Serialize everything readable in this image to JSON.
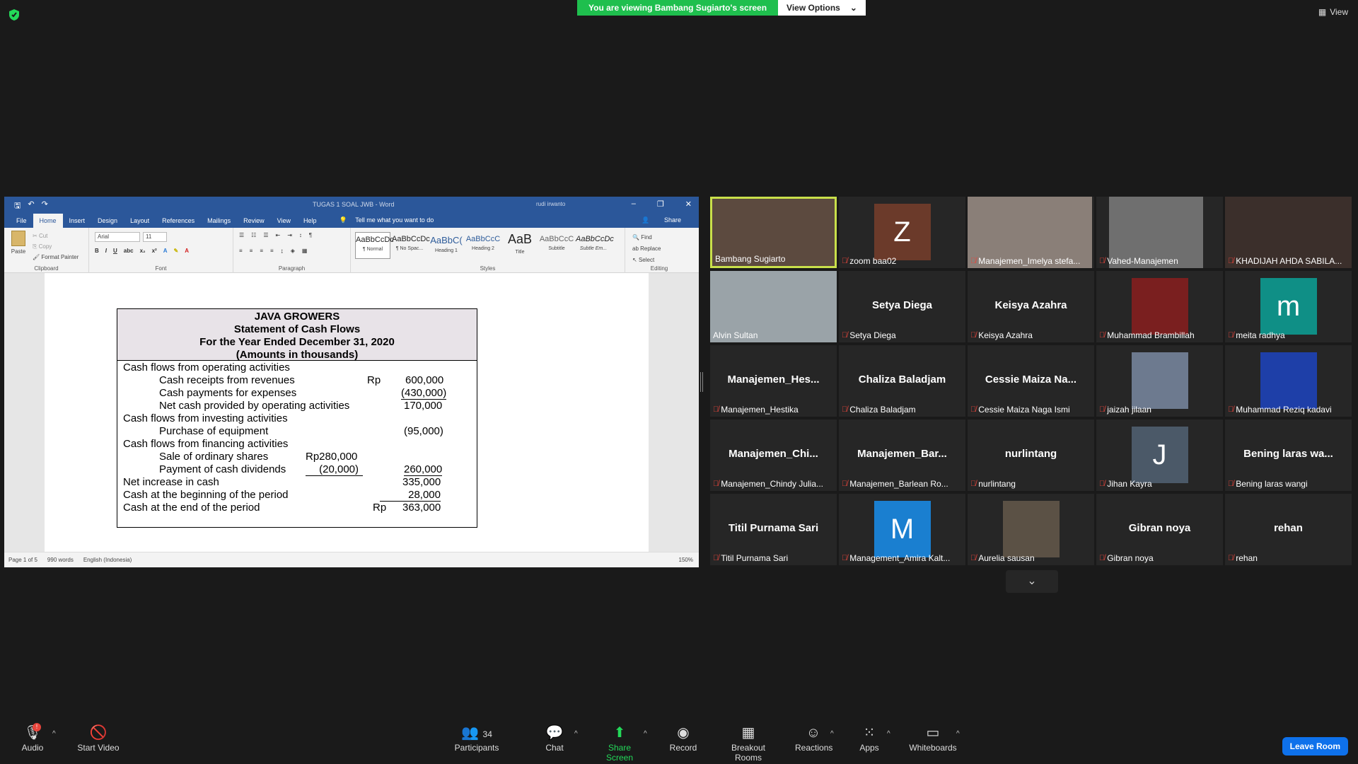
{
  "banner": {
    "viewing": "You are viewing Bambang Sugiarto's screen",
    "view_options": "View Options"
  },
  "view_label": "View",
  "word": {
    "title": "TUGAS 1 SOAL JWB  -  Word",
    "user": "rudi irwanto",
    "tabs": [
      "File",
      "Home",
      "Insert",
      "Design",
      "Layout",
      "References",
      "Mailings",
      "Review",
      "View",
      "Help"
    ],
    "tell_me": "Tell me what you want to do",
    "share": "Share",
    "clipboard": {
      "paste": "Paste",
      "cut": "Cut",
      "copy": "Copy",
      "format_painter": "Format Painter",
      "label": "Clipboard"
    },
    "font": {
      "name": "Arial",
      "size": "11",
      "label": "Font"
    },
    "paragraph_label": "Paragraph",
    "styles": [
      {
        "preview": "AaBbCcDc",
        "name": "¶ Normal"
      },
      {
        "preview": "AaBbCcDc",
        "name": "¶ No Spac..."
      },
      {
        "preview": "AaBbC(",
        "name": "Heading 1"
      },
      {
        "preview": "AaBbCcC",
        "name": "Heading 2"
      },
      {
        "preview": "AaB",
        "name": "Title"
      },
      {
        "preview": "AaBbCcC",
        "name": "Subtitle"
      },
      {
        "preview": "AaBbCcDc",
        "name": "Subtle Em..."
      }
    ],
    "styles_label": "Styles",
    "editing": {
      "find": "Find",
      "replace": "Replace",
      "select": "Select",
      "label": "Editing"
    },
    "status": {
      "page": "Page 1 of 5",
      "words": "990 words",
      "lang": "English (Indonesia)",
      "zoom": "150%"
    }
  },
  "statement": {
    "h1": "JAVA GROWERS",
    "h2": "Statement of Cash Flows",
    "h3": "For the Year Ended December 31, 2020",
    "h4": "(Amounts in thousands)",
    "op": "Cash flows from operating activities",
    "op1": "Cash receipts from revenues",
    "op1_rp": "Rp",
    "op1_v": "600,000",
    "op2": "Cash payments for expenses",
    "op2_v": "(430,000)",
    "op3": "Net cash provided by operating activities",
    "op3_v": "170,000",
    "inv": "Cash flows from investing activities",
    "inv1": "Purchase of equipment",
    "inv1_v": "(95,000)",
    "fin": "Cash flows from financing activities",
    "fin1": "Sale of ordinary shares",
    "fin1_v": "Rp280,000",
    "fin2": "Payment of cash dividends",
    "fin2_v": "(20,000)",
    "fin2_t": "260,000",
    "net": "Net increase in cash",
    "net_v": "335,000",
    "beg": "Cash at the beginning of the period",
    "beg_v": "28,000",
    "end": "Cash at the end of the period",
    "end_rp": "Rp",
    "end_v": "363,000"
  },
  "participants": [
    {
      "big": "",
      "label": "Bambang Sugiarto",
      "muted": false
    },
    {
      "big": "",
      "label": "zoom baa02",
      "muted": true,
      "avatar": "Z",
      "color": "#6b3a2a"
    },
    {
      "big": "",
      "label": "Manajemen_Imelya stefa...",
      "muted": true
    },
    {
      "big": "",
      "label": "Vahed-Manajemen",
      "muted": true
    },
    {
      "big": "",
      "label": "KHADIJAH AHDA SABILA...",
      "muted": true
    },
    {
      "big": "",
      "label": "Alvin Sultan",
      "muted": false
    },
    {
      "big": "Setya Diega",
      "label": "Setya Diega",
      "muted": true
    },
    {
      "big": "Keisya Azahra",
      "label": "Keisya Azahra",
      "muted": true
    },
    {
      "big": "",
      "label": "Muhammad Brambillah",
      "muted": true
    },
    {
      "big": "",
      "label": "meita radhya",
      "muted": true,
      "avatar": "m",
      "color": "#0f8f86"
    },
    {
      "big": "Manajemen_Hes...",
      "label": "Manajemen_Hestika",
      "muted": true
    },
    {
      "big": "Chaliza Baladjam",
      "label": "Chaliza Baladjam",
      "muted": true
    },
    {
      "big": "Cessie Maiza Na...",
      "label": "Cessie Maiza Naga Ismi",
      "muted": true
    },
    {
      "big": "",
      "label": "jaizah jilaan",
      "muted": true
    },
    {
      "big": "",
      "label": "Muhammad Reziq kadavi",
      "muted": true
    },
    {
      "big": "Manajemen_Chi...",
      "label": "Manajemen_Chindy Julia...",
      "muted": true
    },
    {
      "big": "Manajemen_Bar...",
      "label": "Manajemen_Barlean Ro...",
      "muted": true
    },
    {
      "big": "nurlintang",
      "label": "nurlintang",
      "muted": true
    },
    {
      "big": "",
      "label": "Jihan Kayra",
      "muted": true,
      "avatar": "J",
      "color": "#4b5968"
    },
    {
      "big": "Bening laras wa...",
      "label": "Bening laras wangi",
      "muted": true
    },
    {
      "big": "Titil Purnama Sari",
      "label": "Titil Purnama Sari",
      "muted": true
    },
    {
      "big": "",
      "label": "Management_Amira Kalt...",
      "muted": true,
      "avatar": "M",
      "color": "#1a7fd0"
    },
    {
      "big": "",
      "label": "Aurelia sausan",
      "muted": true
    },
    {
      "big": "Gibran noya",
      "label": "Gibran noya",
      "muted": true
    },
    {
      "big": "rehan",
      "label": "rehan",
      "muted": true
    }
  ],
  "toolbar": {
    "audio": "Audio",
    "audio_badge": "!",
    "video": "Start Video",
    "participants": "Participants",
    "participants_count": "34",
    "chat": "Chat",
    "share": "Share Screen",
    "record": "Record",
    "breakout": "Breakout Rooms",
    "reactions": "Reactions",
    "apps": "Apps",
    "whiteboards": "Whiteboards",
    "leave": "Leave Room"
  },
  "colors": {
    "accent_green": "#1fbf4e",
    "leave_blue": "#0e71eb",
    "active_speaker": "#c9e04a",
    "word_blue": "#2b579a"
  }
}
